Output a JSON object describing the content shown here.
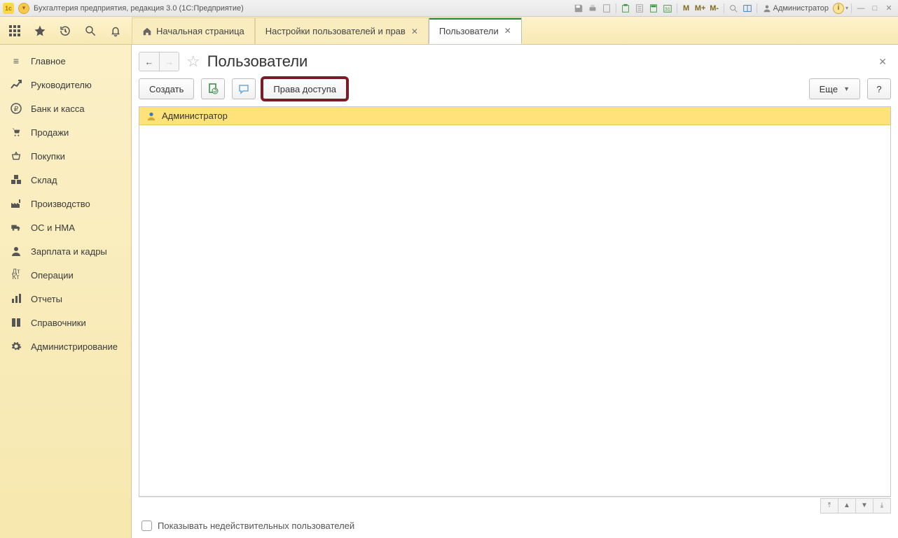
{
  "titlebar": {
    "app_title": "Бухгалтерия предприятия, редакция 3.0  (1С:Предприятие)",
    "user_label": "Администратор",
    "m_labels": [
      "M",
      "M+",
      "M-"
    ]
  },
  "tabs": [
    {
      "label": "Начальная страница",
      "home": true,
      "closable": false,
      "active": false
    },
    {
      "label": "Настройки пользователей и прав",
      "home": false,
      "closable": true,
      "active": false
    },
    {
      "label": "Пользователи",
      "home": false,
      "closable": true,
      "active": true
    }
  ],
  "sidebar": {
    "items": [
      {
        "icon": "menu-icon",
        "label": "Главное"
      },
      {
        "icon": "chart-up-icon",
        "label": "Руководителю"
      },
      {
        "icon": "ruble-icon",
        "label": "Банк и касса"
      },
      {
        "icon": "cart-icon",
        "label": "Продажи"
      },
      {
        "icon": "basket-icon",
        "label": "Покупки"
      },
      {
        "icon": "warehouse-icon",
        "label": "Склад"
      },
      {
        "icon": "factory-icon",
        "label": "Производство"
      },
      {
        "icon": "truck-icon",
        "label": "ОС и НМА"
      },
      {
        "icon": "person-icon",
        "label": "Зарплата и кадры"
      },
      {
        "icon": "operations-icon",
        "label": "Операции"
      },
      {
        "icon": "bars-icon",
        "label": "Отчеты"
      },
      {
        "icon": "book-icon",
        "label": "Справочники"
      },
      {
        "icon": "gear-icon",
        "label": "Администрирование"
      }
    ]
  },
  "page": {
    "title": "Пользователи",
    "toolbar": {
      "create_label": "Создать",
      "rights_label": "Права доступа",
      "more_label": "Еще"
    },
    "list": {
      "rows": [
        {
          "name": "Администратор",
          "selected": true
        }
      ]
    },
    "footer_checkbox": "Показывать недействительных пользователей"
  }
}
